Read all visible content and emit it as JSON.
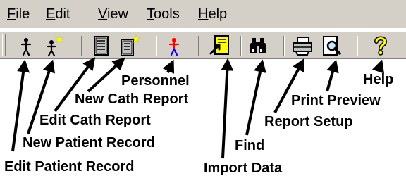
{
  "menu": {
    "items": [
      {
        "label": "File",
        "mnemonic": "F"
      },
      {
        "label": "Edit",
        "mnemonic": "E"
      },
      {
        "label": "View",
        "mnemonic": "V"
      },
      {
        "label": "Tools",
        "mnemonic": "T"
      },
      {
        "label": "Help",
        "mnemonic": "H"
      }
    ]
  },
  "toolbar": {
    "buttons": [
      {
        "icon": "person-icon"
      },
      {
        "icon": "person-new-icon"
      },
      {
        "icon": "cath-report-icon"
      },
      {
        "icon": "cath-report-new-icon"
      },
      {
        "icon": "personnel-icon"
      },
      {
        "icon": "import-data-icon"
      },
      {
        "icon": "binoculars-icon"
      },
      {
        "icon": "printer-icon"
      },
      {
        "icon": "print-preview-icon"
      },
      {
        "icon": "help-question-icon"
      }
    ]
  },
  "callouts": {
    "edit_patient_record": "Edit Patient Record",
    "new_patient_record": "New Patient Record",
    "edit_cath_report": "Edit Cath Report",
    "new_cath_report": "New Cath Report",
    "personnel": "Personnel",
    "import_data": "Import Data",
    "find": "Find",
    "report_setup": "Report Setup",
    "print_preview": "Print Preview",
    "help": "Help"
  },
  "colors": {
    "chrome": "#d4d0c8",
    "highlight_yellow": "#ffff00",
    "personnel_red": "#ff0000",
    "personnel_blue": "#0000ff"
  }
}
